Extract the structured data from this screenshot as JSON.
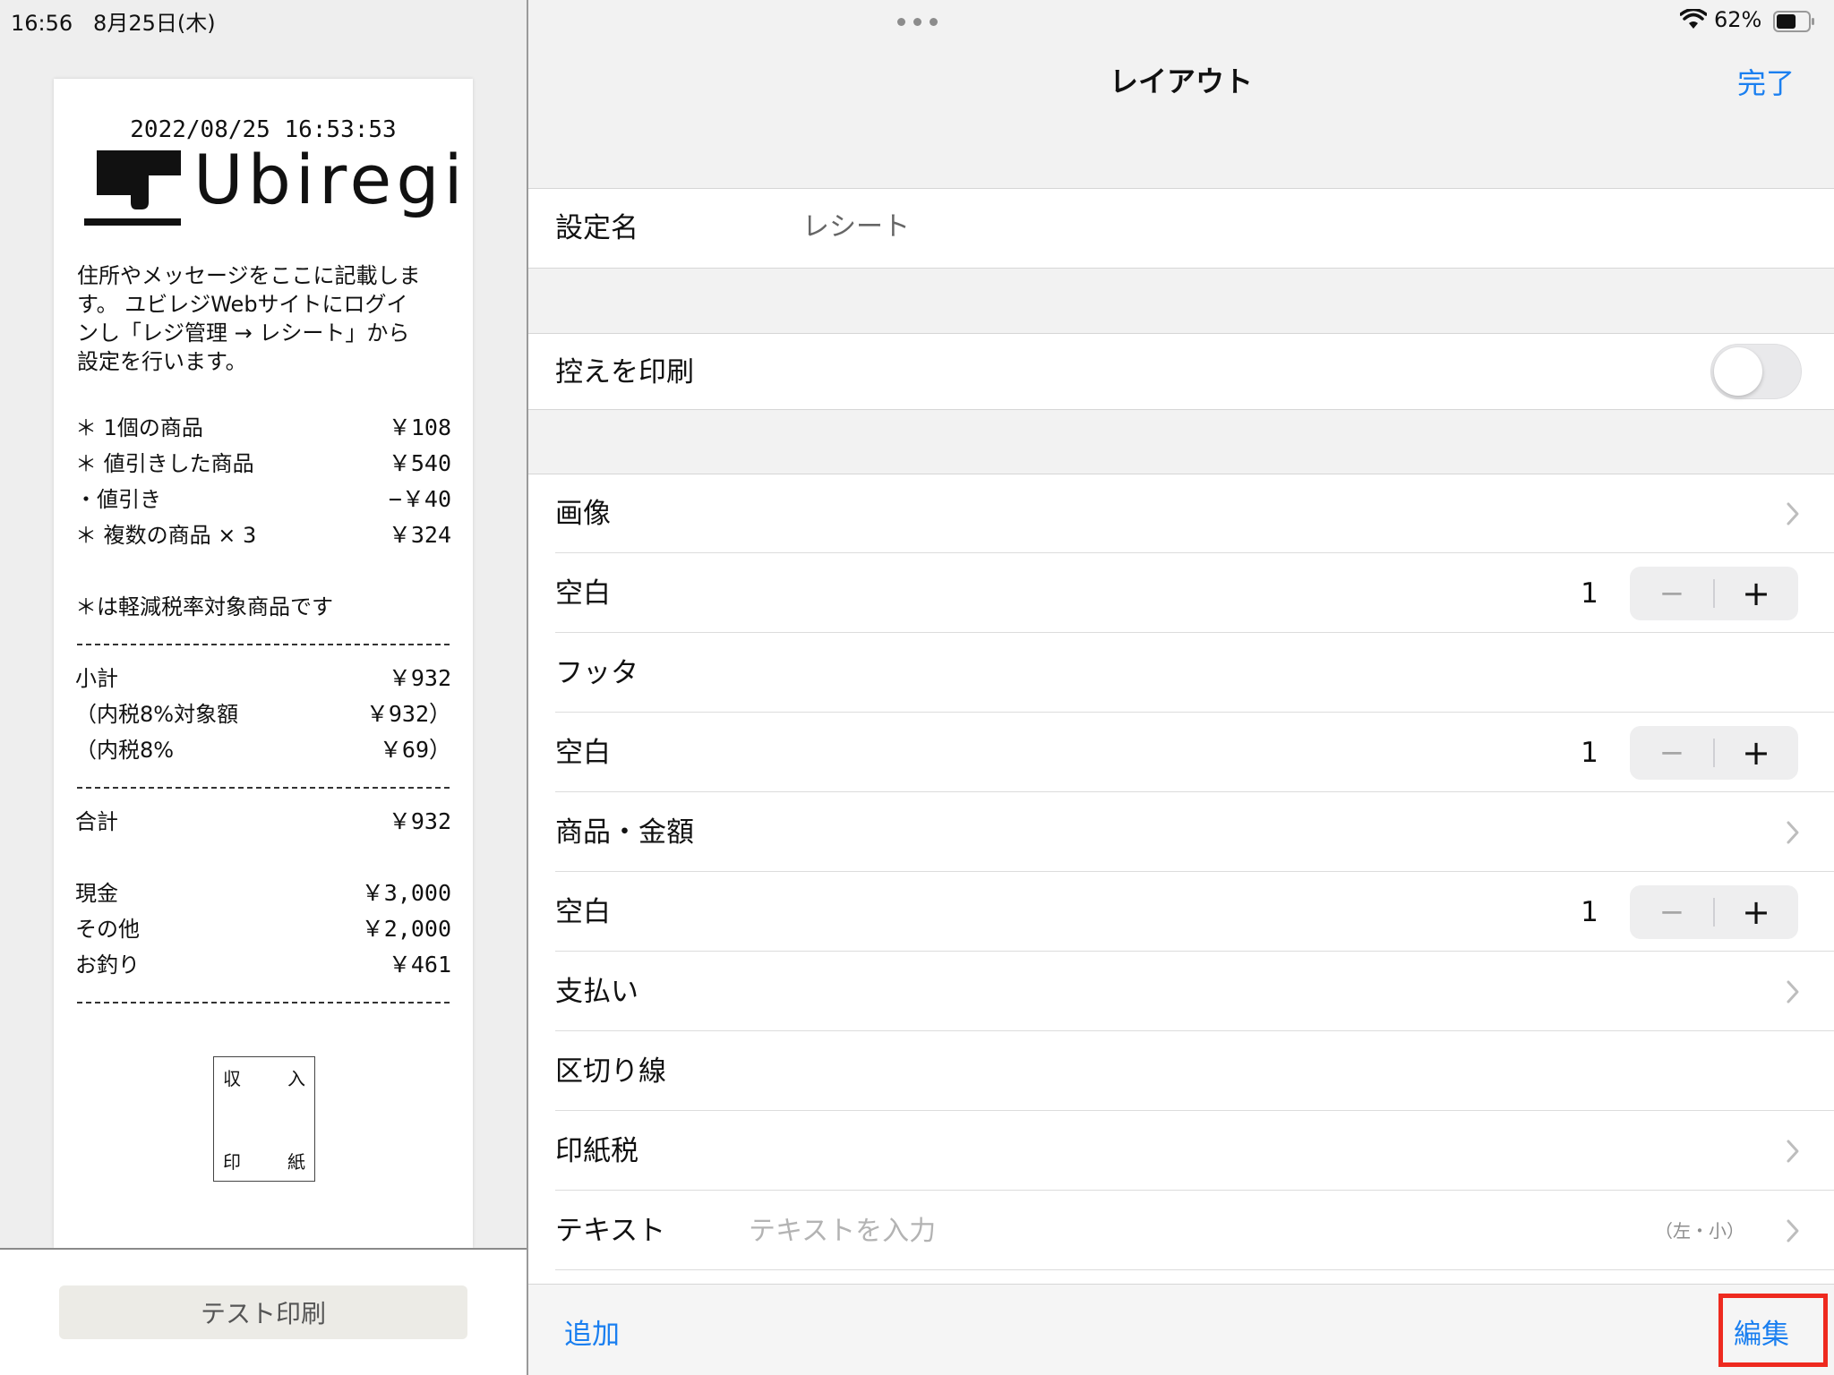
{
  "status_bar": {
    "time_date": "16:56   8月25日(木)",
    "battery_percent": "62%",
    "battery_level": 0.62
  },
  "receipt": {
    "datetime": "2022/08/25 16:53:53",
    "logo_text": "Ubiregi",
    "message_lines": [
      "住所やメッセージをここに記載しま",
      "す。 ユビレジWebサイトにログイ",
      "ンし「レジ管理 → レシート」から",
      "設定を行います。"
    ],
    "items": [
      {
        "label": "＊ 1個の商品",
        "value": "￥108"
      },
      {
        "label": "＊ 値引きした商品",
        "value": "￥540"
      },
      {
        "label": "・値引き",
        "value": "−￥40"
      },
      {
        "label": "＊ 複数の商品 × 3",
        "value": "￥324"
      }
    ],
    "tax_note": "＊は軽減税率対象商品です",
    "subtotals": [
      {
        "label": "小計",
        "value": "￥932"
      },
      {
        "label": "（内税8%対象額",
        "value": "￥932）"
      },
      {
        "label": "（内税8%",
        "value": "￥69）"
      }
    ],
    "total": {
      "label": "合計",
      "value": "￥932"
    },
    "payments": [
      {
        "label": "現金",
        "value": "￥3,000"
      },
      {
        "label": "その他",
        "value": "￥2,000"
      },
      {
        "label": "お釣り",
        "value": "￥461"
      }
    ],
    "stamp_chars": [
      "収",
      "入",
      "印",
      "紙"
    ]
  },
  "test_print_label": "テスト印刷",
  "nav": {
    "title": "レイアウト",
    "done_label": "完了"
  },
  "setting_name": {
    "label": "設定名",
    "value": "レシート"
  },
  "print_copy": {
    "label": "控えを印刷",
    "enabled": false
  },
  "layout_rows": [
    {
      "label": "画像"
    },
    {
      "label": "空白",
      "count": "1",
      "minus": "−",
      "plus": "+"
    },
    {
      "label": "フッタ"
    },
    {
      "label": "空白",
      "count": "1",
      "minus": "−",
      "plus": "+"
    },
    {
      "label": "商品・金額"
    },
    {
      "label": "空白",
      "count": "1",
      "minus": "−",
      "plus": "+"
    },
    {
      "label": "支払い"
    },
    {
      "label": "区切り線"
    },
    {
      "label": "印紙税"
    },
    {
      "label": "テキスト",
      "placeholder": "テキストを入力",
      "meta": "（左・小）"
    }
  ],
  "toolbar": {
    "add_label": "追加",
    "edit_label": "編集"
  },
  "colors": {
    "accent": "#1a7ff0",
    "highlight": "#ee2a1f"
  }
}
